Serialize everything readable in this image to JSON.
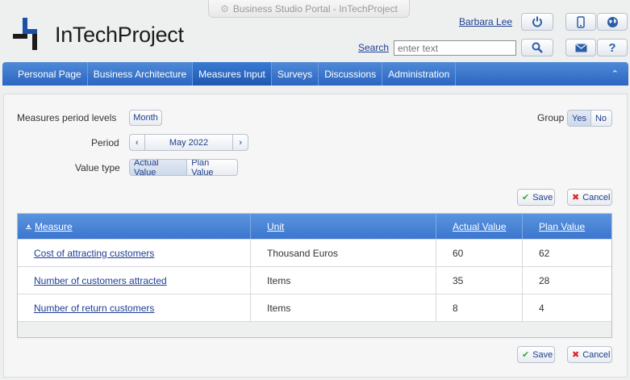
{
  "window": {
    "title": "Business Studio Portal - InTechProject"
  },
  "brand": {
    "name": "InTechProject",
    "accent": "#1b4fa8"
  },
  "header": {
    "user_name": "Barbara Lee",
    "search_label": "Search",
    "search_placeholder": "enter text"
  },
  "nav": {
    "items": [
      "Personal Page",
      "Business Architecture",
      "Measures Input",
      "Surveys",
      "Discussions",
      "Administration"
    ],
    "active": "Measures Input"
  },
  "filters": {
    "period_levels_label": "Measures period levels",
    "period_levels_value": "Month",
    "period_label": "Period",
    "period_value": "May 2022",
    "value_type_label": "Value type",
    "value_type_options": [
      "Actual Value",
      "Plan Value"
    ],
    "group_label": "Group",
    "group_options": [
      "Yes",
      "No"
    ]
  },
  "actions": {
    "save": "Save",
    "cancel": "Cancel"
  },
  "table": {
    "columns": [
      "Measure",
      "Unit",
      "Actual Value",
      "Plan Value"
    ],
    "rows": [
      {
        "measure": "Cost of attracting customers",
        "unit": "Thousand Euros",
        "actual": "60",
        "plan": "62"
      },
      {
        "measure": "Number of customers attracted",
        "unit": "Items",
        "actual": "35",
        "plan": "28"
      },
      {
        "measure": "Number of return customers",
        "unit": "Items",
        "actual": "8",
        "plan": "4"
      }
    ]
  }
}
